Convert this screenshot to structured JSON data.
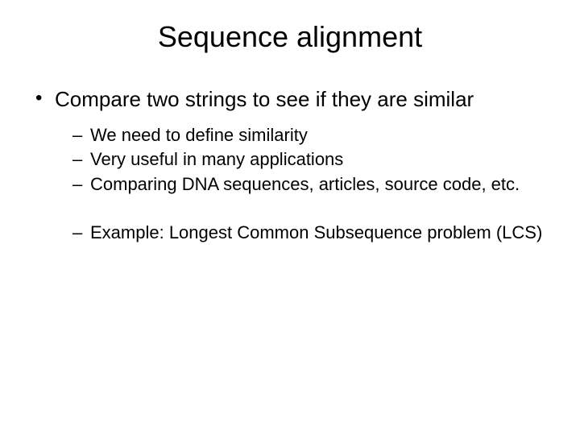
{
  "title": "Sequence alignment",
  "bullets": {
    "main": "Compare two strings to see if they are similar",
    "sub1": "We need to define similarity",
    "sub2": "Very useful in many applications",
    "sub3": "Comparing DNA sequences, articles, source code, etc.",
    "sub4": "Example: Longest Common Subsequence problem (LCS)"
  }
}
